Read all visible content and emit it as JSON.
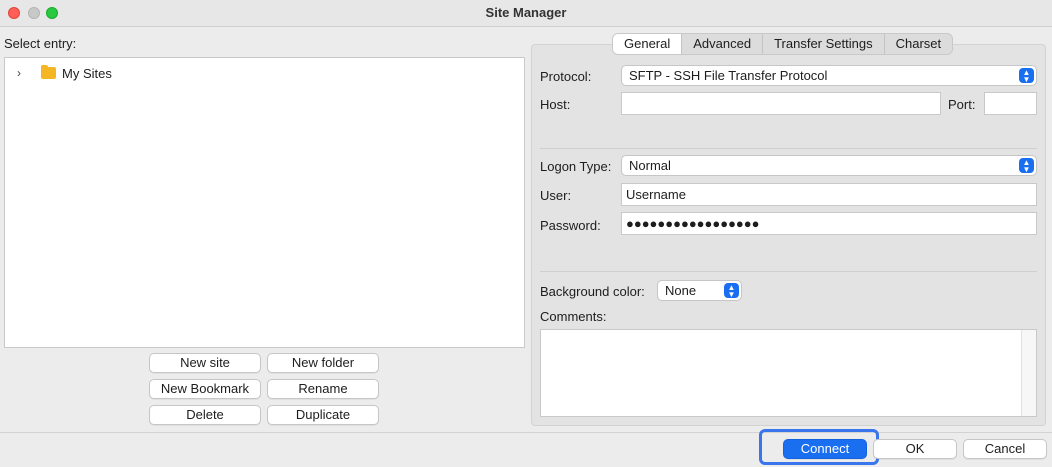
{
  "window": {
    "title": "Site Manager"
  },
  "left": {
    "select_entry_label": "Select entry:",
    "tree": [
      {
        "label": "My Sites",
        "icon": "folder-icon",
        "expanded": false
      }
    ],
    "buttons": {
      "new_site": "New site",
      "new_folder": "New folder",
      "new_bookmark": "New Bookmark",
      "rename": "Rename",
      "delete": "Delete",
      "duplicate": "Duplicate"
    }
  },
  "tabs": [
    {
      "label": "General",
      "active": true
    },
    {
      "label": "Advanced",
      "active": false
    },
    {
      "label": "Transfer Settings",
      "active": false
    },
    {
      "label": "Charset",
      "active": false
    }
  ],
  "general": {
    "protocol_label": "Protocol:",
    "protocol_value": "SFTP - SSH File Transfer Protocol",
    "host_label": "Host:",
    "host_value": "",
    "port_label": "Port:",
    "port_value": "",
    "logon_type_label": "Logon Type:",
    "logon_type_value": "Normal",
    "user_label": "User:",
    "user_value": "Username",
    "password_label": "Password:",
    "password_value": "●●●●●●●●●●●●●●●●●",
    "background_color_label": "Background color:",
    "background_color_value": "None",
    "comments_label": "Comments:",
    "comments_value": ""
  },
  "footer": {
    "connect": "Connect",
    "ok": "OK",
    "cancel": "Cancel"
  },
  "colors": {
    "accent": "#1a6ff1",
    "folder": "#f5b624"
  }
}
